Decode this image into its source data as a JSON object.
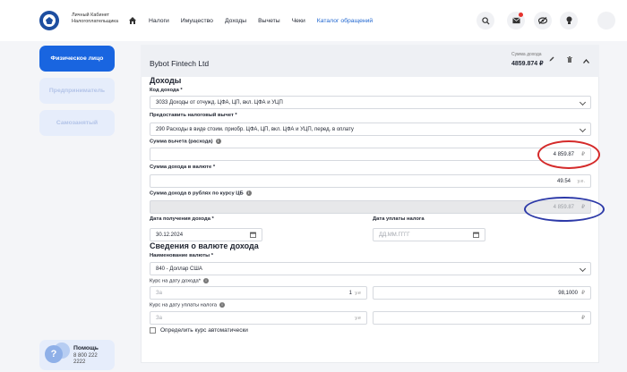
{
  "header": {
    "logo_text": "Личный Кабинет Налогоплательщика",
    "nav": [
      "Налоги",
      "Имущество",
      "Доходы",
      "Вычеты",
      "Чеки",
      "Каталог обращений"
    ]
  },
  "sidebar": {
    "items": [
      {
        "label": "Физическое лицо",
        "active": true
      },
      {
        "label": "Предприниматель",
        "active": false
      },
      {
        "label": "Самозанятый",
        "active": false
      }
    ],
    "help": {
      "title": "Помощь",
      "phone": "8 800 222 2222"
    }
  },
  "card": {
    "company": "Bybot Fintech Ltd",
    "sum_label": "Сумма дохода",
    "sum_value": "4859.874 ₽"
  },
  "form": {
    "section_income": "Доходы",
    "income_code_label": "Код дохода *",
    "income_code_value": "3033 Доходы от отчужд. ЦФА, ЦП, вкл. ЦФА и УЦП",
    "deduction_label": "Предоставить налоговый вычет *",
    "deduction_value": "290 Расходы в виде стоим. приобр. ЦФА, ЦП, вкл. ЦФА и УЦП, перед. в оплату",
    "deduction_sum_label": "Сумма вычета (расхода)",
    "deduction_sum_value": "4 859.87",
    "rub": "₽",
    "income_currency_label": "Сумма дохода в валюте *",
    "income_currency_value": "49.54",
    "unit_ue": "у.е.",
    "income_rub_label": "Сумма дохода в рублях по курсу ЦБ",
    "income_rub_value": "4 859.87",
    "date_income_label": "Дата получения дохода *",
    "date_income_value": "30.12.2024",
    "date_tax_label": "Дата уплаты налога",
    "date_tax_placeholder": "ДД.ММ.ГГГГ",
    "section_currency": "Сведения о валюте дохода",
    "currency_name_label": "Наименование валюты *",
    "currency_name_value": "840 - Доллар США",
    "rate_income_label": "Курс на дату дохода*",
    "rate_placeholder": "За",
    "rate_units": "1",
    "unit_ue_short": "у.е",
    "rate_income_value": "98,1000",
    "rate_tax_label": "Курс на дату уплаты налога",
    "auto_rate_label": "Определить курс автоматически"
  },
  "colors": {
    "accent": "#2167d0",
    "red_ring": "#d42a2a",
    "blue_ring": "#2d3aa8"
  }
}
